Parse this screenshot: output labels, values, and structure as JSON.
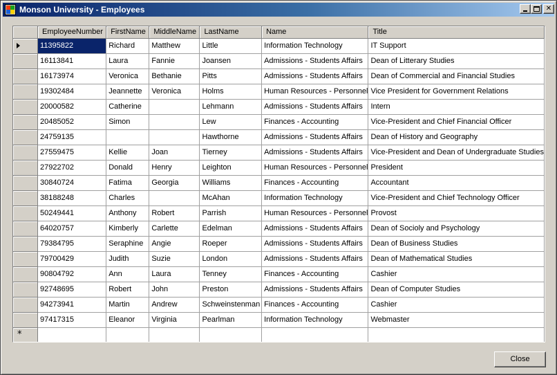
{
  "window": {
    "title": "Monson University - Employees"
  },
  "grid": {
    "columns": [
      "EmployeeNumber",
      "FirstName",
      "MiddleName",
      "LastName",
      "Name",
      "Title"
    ],
    "rows": [
      [
        "11395822",
        "Richard",
        "Matthew",
        "Little",
        "Information Technology",
        "IT Support"
      ],
      [
        "16113841",
        "Laura",
        "Fannie",
        "Joansen",
        "Admissions - Students Affairs",
        "Dean of Litterary Studies"
      ],
      [
        "16173974",
        "Veronica",
        "Bethanie",
        "Pitts",
        "Admissions - Students Affairs",
        "Dean of Commercial and Financial Studies"
      ],
      [
        "19302484",
        "Jeannette",
        "Veronica",
        "Holms",
        "Human Resources - Personnel",
        "Vice President for Government Relations"
      ],
      [
        "20000582",
        "Catherine",
        "",
        "Lehmann",
        "Admissions - Students Affairs",
        "Intern"
      ],
      [
        "20485052",
        "Simon",
        "",
        "Lew",
        "Finances - Accounting",
        "Vice-President and Chief Financial Officer"
      ],
      [
        "24759135",
        "",
        "",
        "Hawthorne",
        "Admissions - Students Affairs",
        "Dean of History and Geography"
      ],
      [
        "27559475",
        "Kellie",
        "Joan",
        "Tierney",
        "Admissions - Students Affairs",
        "Vice-President and Dean of Undergraduate Studies"
      ],
      [
        "27922702",
        "Donald",
        "Henry",
        "Leighton",
        "Human Resources - Personnel",
        "President"
      ],
      [
        "30840724",
        "Fatima",
        "Georgia",
        "Williams",
        "Finances - Accounting",
        "Accountant"
      ],
      [
        "38188248",
        "Charles",
        "",
        "McAhan",
        "Information Technology",
        "Vice-President and Chief Technology Officer"
      ],
      [
        "50249441",
        "Anthony",
        "Robert",
        "Parrish",
        "Human Resources - Personnel",
        "Provost"
      ],
      [
        "64020757",
        "Kimberly",
        "Carlette",
        "Edelman",
        "Admissions - Students Affairs",
        "Dean of Socioly and Psychology"
      ],
      [
        "79384795",
        "Seraphine",
        "Angie",
        "Roeper",
        "Admissions - Students Affairs",
        "Dean of Business Studies"
      ],
      [
        "79700429",
        "Judith",
        "Suzie",
        "London",
        "Admissions - Students Affairs",
        "Dean of Mathematical Studies"
      ],
      [
        "90804792",
        "Ann",
        "Laura",
        "Tenney",
        "Finances - Accounting",
        "Cashier"
      ],
      [
        "92748695",
        "Robert",
        "John",
        "Preston",
        "Admissions - Students Affairs",
        "Dean of Computer Studies"
      ],
      [
        "94273941",
        "Martin",
        "Andrew",
        "Schweinstenman",
        "Finances - Accounting",
        "Cashier"
      ],
      [
        "97417315",
        "Eleanor",
        "Virginia",
        "Pearlman",
        "Information Technology",
        "Webmaster"
      ]
    ],
    "new_row_marker": "*"
  },
  "buttons": {
    "close_label": "Close"
  },
  "icons": {
    "app": "app-form-icon",
    "minimize": "minimize-icon",
    "maximize": "maximize-icon",
    "close": "close-icon",
    "current_row": "current-row-arrow-icon"
  },
  "colors": {
    "title_start": "#0a246a",
    "title_end": "#a6caf0",
    "selection": "#0a246a",
    "face": "#d4d0c8"
  }
}
